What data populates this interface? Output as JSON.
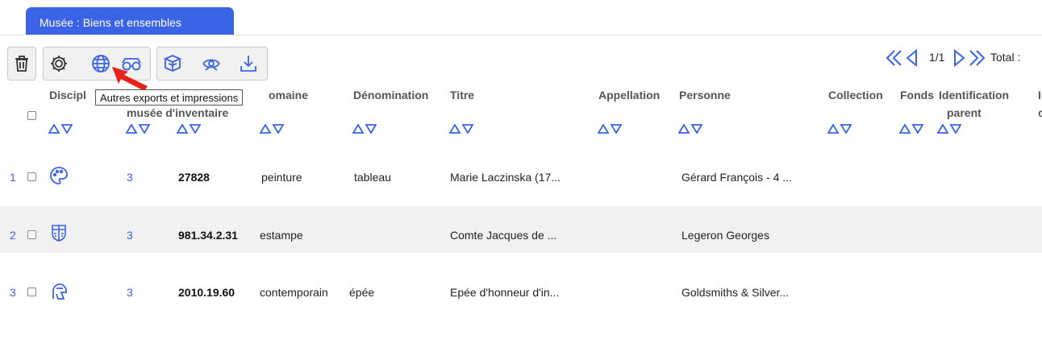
{
  "tab": {
    "label": "Musée : Biens et ensembles"
  },
  "toolbar": {
    "tooltip": "Autres exports et impressions",
    "buttons": [
      "trash-icon",
      "gear-icon",
      "globe-icon",
      "glasses-icon",
      "boxes-icon",
      "hand-eye-icon",
      "download-icon"
    ]
  },
  "pager": {
    "page": "1/1",
    "total_label": "Total :"
  },
  "columns": {
    "discipline": "Discipl",
    "musee_inventaire": "musée d'inventaire",
    "domaine": "omaine",
    "denomination": "Dénomination",
    "titre": "Titre",
    "appellation": "Appellation",
    "personne": "Personne",
    "collection": "Collection",
    "fonds": "Fonds",
    "identification": "Identification",
    "parent": "parent",
    "edge1": "I",
    "edge2": "c"
  },
  "rows": [
    {
      "index": "1",
      "icon": "palette-icon",
      "col2": "3",
      "inventory": "27828",
      "domaine": "peinture",
      "denomination": "tableau",
      "titre": "Marie Laczinska (17...",
      "personne": "Gérard François - 4 ..."
    },
    {
      "index": "2",
      "icon": "stamp-icon",
      "col2": "3",
      "inventory": "981.34.2.31",
      "domaine": "estampe",
      "denomination": "",
      "titre": "Comte Jacques de ...",
      "personne": "Legeron Georges"
    },
    {
      "index": "3",
      "icon": "helmet-icon",
      "col2": "3",
      "inventory": "2010.19.60",
      "domaine": "contemporain",
      "denomination": "épée",
      "titre": "Epée d'honneur d'in...",
      "personne": "Goldsmiths & Silver..."
    }
  ],
  "colors": {
    "accent": "#3b63e6",
    "arrow": "#e8211a",
    "row_shade": "#f1f1f1"
  }
}
